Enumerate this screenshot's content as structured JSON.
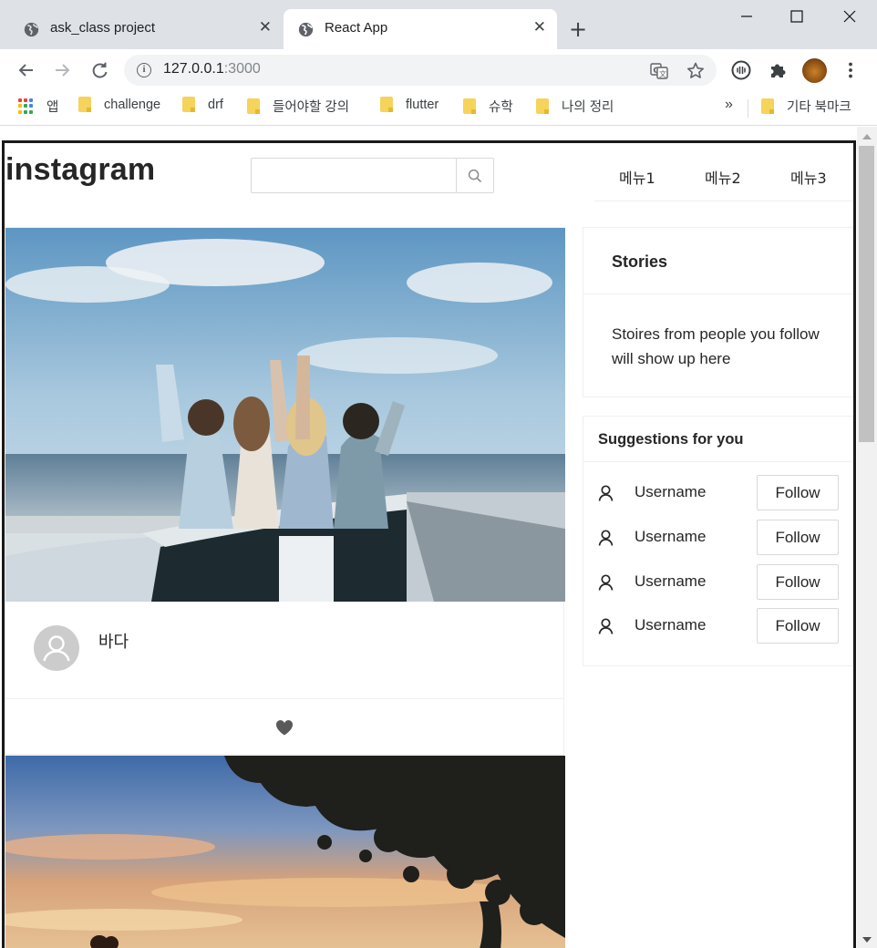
{
  "browser": {
    "tabs": [
      {
        "title": "ask_class project",
        "active": false
      },
      {
        "title": "React App",
        "active": true
      }
    ],
    "url_host": "127.0.0.1",
    "url_port": ":3000",
    "bookmarks": [
      {
        "label": "앱",
        "type": "apps"
      },
      {
        "label": "challenge",
        "type": "folder"
      },
      {
        "label": "drf",
        "type": "folder"
      },
      {
        "label": "들어야할 강의",
        "type": "folder"
      },
      {
        "label": "flutter",
        "type": "folder"
      },
      {
        "label": "슈학",
        "type": "folder"
      },
      {
        "label": "나의 정리",
        "type": "folder"
      }
    ],
    "bookmarks_overflow": "»",
    "other_bookmarks": "기타 북마크"
  },
  "header": {
    "logo": "instagram",
    "search_placeholder": "",
    "menu": [
      "메뉴1",
      "메뉴2",
      "메뉴3"
    ]
  },
  "feed": {
    "posts": [
      {
        "author": "바다",
        "image": "friends-in-convertible-by-sea",
        "liked": false
      },
      {
        "author": "",
        "image": "sunset-under-tree",
        "liked": false
      }
    ]
  },
  "sidebar": {
    "stories": {
      "title": "Stories",
      "empty_text": "Stoires from people you follow will show up here"
    },
    "suggestions": {
      "title": "Suggestions for you",
      "users": [
        {
          "name": "Username",
          "button": "Follow"
        },
        {
          "name": "Username",
          "button": "Follow"
        },
        {
          "name": "Username",
          "button": "Follow"
        },
        {
          "name": "Username",
          "button": "Follow"
        }
      ]
    }
  },
  "colors": {
    "text": "#262626",
    "border": "#f0f0f0",
    "tabstrip": "#dee1e6",
    "heart": "#595959"
  }
}
